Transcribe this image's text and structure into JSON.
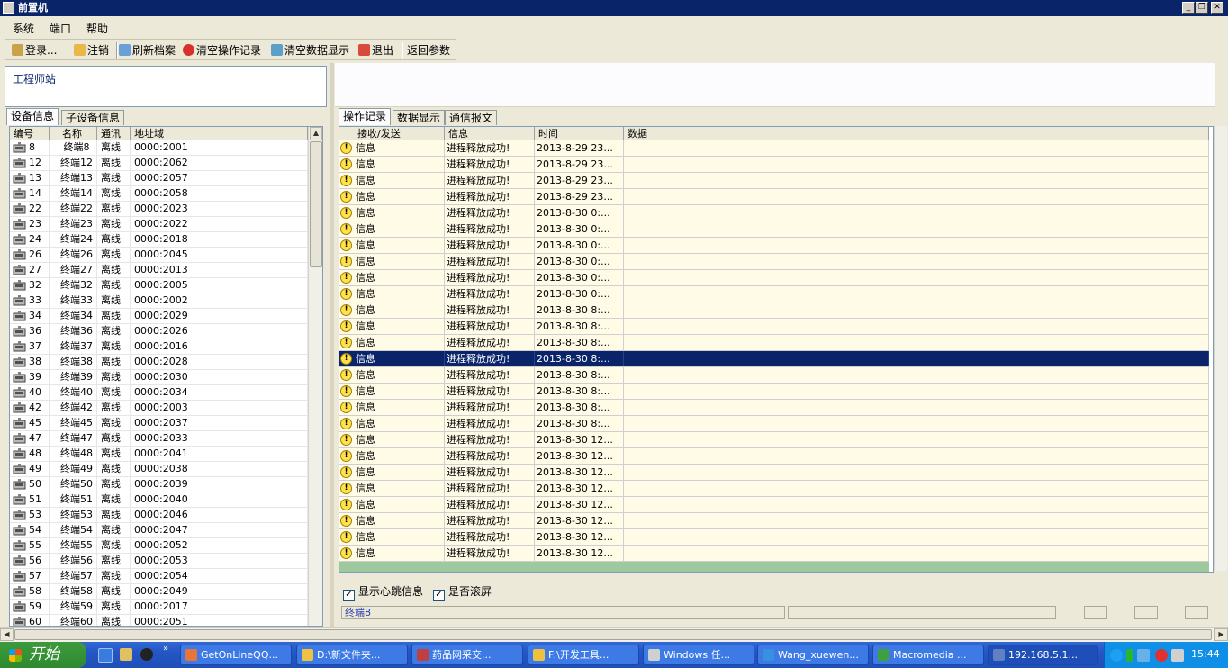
{
  "window": {
    "title": "前置机"
  },
  "menu": [
    "系统",
    "端口",
    "帮助"
  ],
  "toolbar": {
    "login": "登录...",
    "logout": "注销",
    "refresh": "刷新档案",
    "clear_ops": "清空操作记录",
    "clear_data": "清空数据显示",
    "exit": "退出",
    "params": "返回参数"
  },
  "left": {
    "station": "工程师站",
    "tabs": [
      "设备信息",
      "子设备信息"
    ],
    "columns": [
      "编号",
      "名称",
      "通讯",
      "地址域"
    ],
    "rows": [
      [
        "8",
        "终端8",
        "离线",
        "0000:2001"
      ],
      [
        "12",
        "终端12",
        "离线",
        "0000:2062"
      ],
      [
        "13",
        "终端13",
        "离线",
        "0000:2057"
      ],
      [
        "14",
        "终端14",
        "离线",
        "0000:2058"
      ],
      [
        "22",
        "终端22",
        "离线",
        "0000:2023"
      ],
      [
        "23",
        "终端23",
        "离线",
        "0000:2022"
      ],
      [
        "24",
        "终端24",
        "离线",
        "0000:2018"
      ],
      [
        "26",
        "终端26",
        "离线",
        "0000:2045"
      ],
      [
        "27",
        "终端27",
        "离线",
        "0000:2013"
      ],
      [
        "32",
        "终端32",
        "离线",
        "0000:2005"
      ],
      [
        "33",
        "终端33",
        "离线",
        "0000:2002"
      ],
      [
        "34",
        "终端34",
        "离线",
        "0000:2029"
      ],
      [
        "36",
        "终端36",
        "离线",
        "0000:2026"
      ],
      [
        "37",
        "终端37",
        "离线",
        "0000:2016"
      ],
      [
        "38",
        "终端38",
        "离线",
        "0000:2028"
      ],
      [
        "39",
        "终端39",
        "离线",
        "0000:2030"
      ],
      [
        "40",
        "终端40",
        "离线",
        "0000:2034"
      ],
      [
        "42",
        "终端42",
        "离线",
        "0000:2003"
      ],
      [
        "45",
        "终端45",
        "离线",
        "0000:2037"
      ],
      [
        "47",
        "终端47",
        "离线",
        "0000:2033"
      ],
      [
        "48",
        "终端48",
        "离线",
        "0000:2041"
      ],
      [
        "49",
        "终端49",
        "离线",
        "0000:2038"
      ],
      [
        "50",
        "终端50",
        "离线",
        "0000:2039"
      ],
      [
        "51",
        "终端51",
        "离线",
        "0000:2040"
      ],
      [
        "53",
        "终端53",
        "离线",
        "0000:2046"
      ],
      [
        "54",
        "终端54",
        "离线",
        "0000:2047"
      ],
      [
        "55",
        "终端55",
        "离线",
        "0000:2052"
      ],
      [
        "56",
        "终端56",
        "离线",
        "0000:2053"
      ],
      [
        "57",
        "终端57",
        "离线",
        "0000:2054"
      ],
      [
        "58",
        "终端58",
        "离线",
        "0000:2049"
      ],
      [
        "59",
        "终端59",
        "离线",
        "0000:2017"
      ],
      [
        "60",
        "终端60",
        "离线",
        "0000:2051"
      ]
    ]
  },
  "right": {
    "tabs": [
      "操作记录",
      "数据显示",
      "通信报文"
    ],
    "columns": [
      "接收/发送",
      "信息",
      "时间",
      "数据"
    ],
    "rows": [
      [
        "信息",
        "进程释放成功!",
        "2013-8-29 23...",
        ""
      ],
      [
        "信息",
        "进程释放成功!",
        "2013-8-29 23...",
        ""
      ],
      [
        "信息",
        "进程释放成功!",
        "2013-8-29 23...",
        ""
      ],
      [
        "信息",
        "进程释放成功!",
        "2013-8-29 23...",
        ""
      ],
      [
        "信息",
        "进程释放成功!",
        "2013-8-30 0:...",
        ""
      ],
      [
        "信息",
        "进程释放成功!",
        "2013-8-30 0:...",
        ""
      ],
      [
        "信息",
        "进程释放成功!",
        "2013-8-30 0:...",
        ""
      ],
      [
        "信息",
        "进程释放成功!",
        "2013-8-30 0:...",
        ""
      ],
      [
        "信息",
        "进程释放成功!",
        "2013-8-30 0:...",
        ""
      ],
      [
        "信息",
        "进程释放成功!",
        "2013-8-30 0:...",
        ""
      ],
      [
        "信息",
        "进程释放成功!",
        "2013-8-30 8:...",
        ""
      ],
      [
        "信息",
        "进程释放成功!",
        "2013-8-30 8:...",
        ""
      ],
      [
        "信息",
        "进程释放成功!",
        "2013-8-30 8:...",
        ""
      ],
      [
        "信息",
        "进程释放成功!",
        "2013-8-30 8:...",
        ""
      ],
      [
        "信息",
        "进程释放成功!",
        "2013-8-30 8:...",
        ""
      ],
      [
        "信息",
        "进程释放成功!",
        "2013-8-30 8:...",
        ""
      ],
      [
        "信息",
        "进程释放成功!",
        "2013-8-30 8:...",
        ""
      ],
      [
        "信息",
        "进程释放成功!",
        "2013-8-30 8:...",
        ""
      ],
      [
        "信息",
        "进程释放成功!",
        "2013-8-30 12...",
        ""
      ],
      [
        "信息",
        "进程释放成功!",
        "2013-8-30 12...",
        ""
      ],
      [
        "信息",
        "进程释放成功!",
        "2013-8-30 12...",
        ""
      ],
      [
        "信息",
        "进程释放成功!",
        "2013-8-30 12...",
        ""
      ],
      [
        "信息",
        "进程释放成功!",
        "2013-8-30 12...",
        ""
      ],
      [
        "信息",
        "进程释放成功!",
        "2013-8-30 12...",
        ""
      ],
      [
        "信息",
        "进程释放成功!",
        "2013-8-30 12...",
        ""
      ],
      [
        "信息",
        "进程释放成功!",
        "2013-8-30 12...",
        ""
      ]
    ],
    "selected_row": 13,
    "check_heartbeat": "显示心跳信息",
    "check_scroll": "是否滚屏"
  },
  "status": {
    "terminal": "终端8"
  },
  "taskbar": {
    "start": "开始",
    "buttons": [
      "GetOnLineQQ...",
      "D:\\新文件夹...",
      "药品网采交...",
      "F:\\开发工具...",
      "Windows 任...",
      "Wang_xuewen...",
      "Macromedia ...",
      "192.168.5.1..."
    ],
    "clock": "15:44"
  },
  "colors": {
    "titlebar": "#0a246a",
    "selection": "#0a246a",
    "row_bg": "#fffbe6",
    "taskbar": "#245edb",
    "start": "#3a993a"
  }
}
